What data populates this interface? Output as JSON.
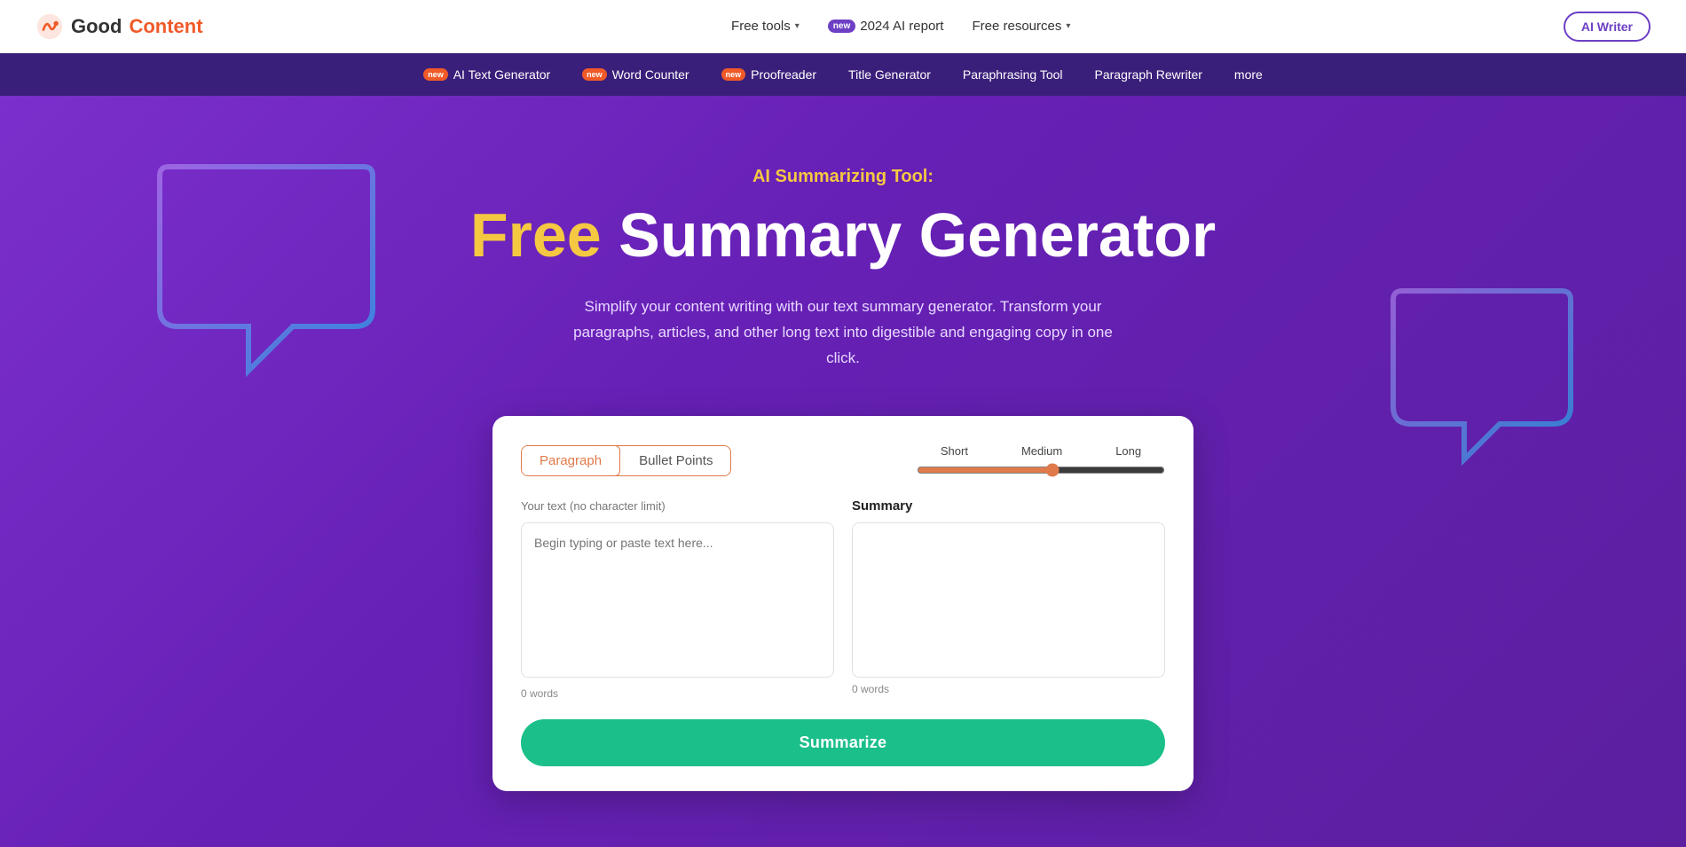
{
  "navbar": {
    "logo_good": "Good",
    "logo_content": "Content",
    "nav_links": [
      {
        "id": "free-tools",
        "label": "Free tools",
        "has_chevron": true,
        "badge": null
      },
      {
        "id": "ai-report",
        "label": "2024 AI report",
        "has_chevron": false,
        "badge": "new"
      },
      {
        "id": "free-resources",
        "label": "Free resources",
        "has_chevron": true,
        "badge": null
      },
      {
        "id": "ai-writer",
        "label": "AI Writer",
        "has_chevron": false,
        "badge": null,
        "is_button": true
      }
    ]
  },
  "subnav": {
    "items": [
      {
        "id": "ai-text-gen",
        "label": "AI Text Generator",
        "badge": "new"
      },
      {
        "id": "word-counter",
        "label": "Word Counter",
        "badge": "new"
      },
      {
        "id": "proofreader",
        "label": "Proofreader",
        "badge": "new"
      },
      {
        "id": "title-gen",
        "label": "Title Generator",
        "badge": null
      },
      {
        "id": "paraphrasing",
        "label": "Paraphrasing Tool",
        "badge": null
      },
      {
        "id": "paragraph-rewriter",
        "label": "Paragraph Rewriter",
        "badge": null
      }
    ],
    "more_label": "more"
  },
  "hero": {
    "subtitle": "AI Summarizing Tool:",
    "title_free": "Free",
    "title_rest": " Summary Generator",
    "description": "Simplify your content writing with our text summary generator. Transform your paragraphs, articles, and other long text into digestible and engaging copy in one click."
  },
  "tool": {
    "tabs": [
      {
        "id": "paragraph",
        "label": "Paragraph",
        "active": true
      },
      {
        "id": "bullet-points",
        "label": "Bullet Points",
        "active": false
      }
    ],
    "slider": {
      "labels": [
        "Short",
        "Medium",
        "Long"
      ],
      "value": 55
    },
    "input_label": "Your text",
    "input_sublabel": "(no character limit)",
    "input_placeholder": "Begin typing or paste text here...",
    "input_word_count": "0 words",
    "output_label": "Summary",
    "output_word_count": "0 words",
    "generate_button": "Summarize"
  }
}
